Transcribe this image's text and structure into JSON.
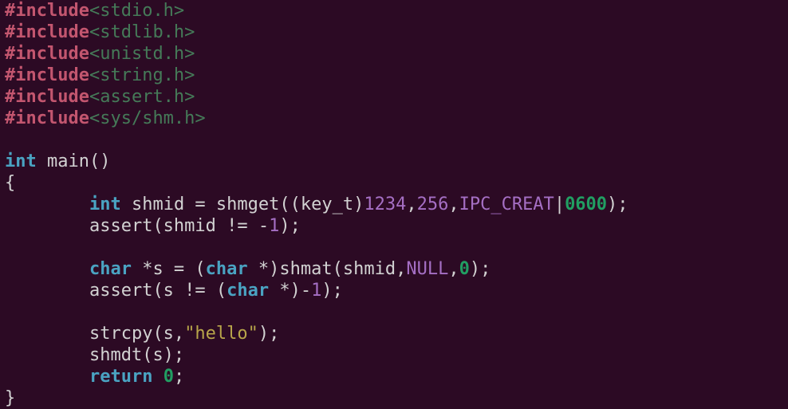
{
  "code": {
    "includes": [
      {
        "directive": "#include",
        "header": "<stdio.h>"
      },
      {
        "directive": "#include",
        "header": "<stdlib.h>"
      },
      {
        "directive": "#include",
        "header": "<unistd.h>"
      },
      {
        "directive": "#include",
        "header": "<string.h>"
      },
      {
        "directive": "#include",
        "header": "<assert.h>"
      },
      {
        "directive": "#include",
        "header": "<sys/shm.h>"
      }
    ],
    "main_sig": {
      "ret": "int",
      "name": "main",
      "parens": "()"
    },
    "brace_open": "{",
    "brace_close": "}",
    "line1": {
      "kw": "int",
      "ident": " shmid = shmget((key_t)",
      "n1": "1234",
      "c1": ",",
      "n2": "256",
      "c2": ",",
      "const1": "IPC_CREAT",
      "pipe": "|",
      "n3": "0600",
      "end": ");"
    },
    "line2": {
      "text": "assert(shmid != -",
      "n": "1",
      "end": ");"
    },
    "line3": {
      "kw1": "char",
      "mid1": " *s = (",
      "kw2": "char",
      "mid2": " *)shmat(shmid,",
      "null": "NULL",
      "c": ",",
      "n": "0",
      "end": ");"
    },
    "line4": {
      "pre": "assert(s != (",
      "kw": "char",
      "mid": " *)-",
      "n": "1",
      "end": ");"
    },
    "line5": {
      "pre": "strcpy(s,",
      "str": "\"hello\"",
      "end": ");"
    },
    "line6": {
      "text": "shmdt(s);"
    },
    "line7": {
      "kw": "return",
      "sp": " ",
      "n": "0",
      "end": ";"
    }
  }
}
